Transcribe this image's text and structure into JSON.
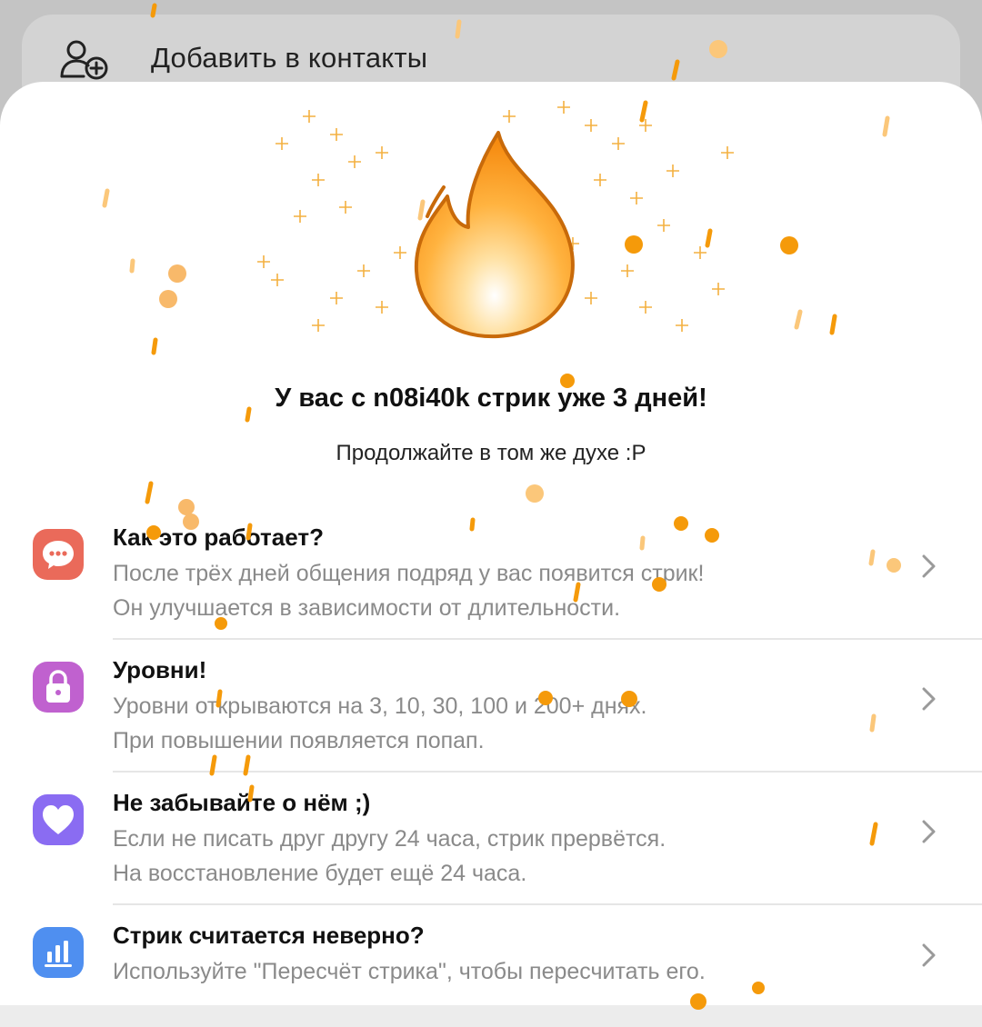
{
  "top_menu": {
    "label": "Добавить в контакты",
    "icon": "add-user-icon"
  },
  "streak": {
    "headline": "У вас с n08i40k стрик уже 3 дней!",
    "subline": "Продолжайте в том же духе :P",
    "icon": "fire-icon"
  },
  "info_items": [
    {
      "title": "Как это работает?",
      "line1": "После трёх дней общения подряд у вас появится стрик!",
      "line2": "Он улучшается в зависимости от длительности.",
      "icon": "chat-bubble-icon",
      "color": "#ea6a5a"
    },
    {
      "title": "Уровни!",
      "line1": "Уровни открываются на 3, 10, 30, 100 и 200+ днях.",
      "line2": "При повышении появляется попап.",
      "icon": "lock-icon",
      "color": "#c061cf"
    },
    {
      "title": "Не забывайте о нём ;)",
      "line1": "Если не писать друг другу 24 часа, стрик прервётся.",
      "line2": "На восстановление будет ещё 24 часа.",
      "icon": "heart-icon",
      "color": "#8a6cf2"
    },
    {
      "title": "Стрик считается неверно?",
      "line1": "Используйте \"Пересчёт стрика\", чтобы пересчитать его.",
      "line2": "",
      "icon": "bar-chart-icon",
      "color": "#4f8ff0"
    }
  ],
  "colors": {
    "accent": "#f59a0a",
    "sheet": "#ffffff",
    "backdrop": "#c4c4c4"
  }
}
